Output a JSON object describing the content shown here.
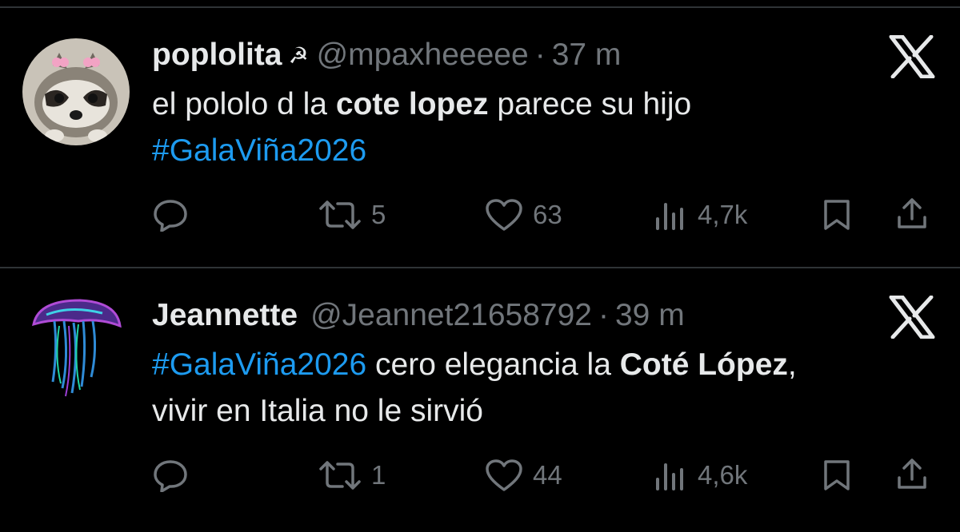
{
  "tweets": [
    {
      "display_name": "poplolita",
      "badge": "☭",
      "handle": "@mpaxheeeee",
      "separator": "·",
      "time": "37 m",
      "text": {
        "part1": "el pololo d la ",
        "bold1": "cote lopez",
        "part2": " parece su hijo",
        "hashtag": "#GalaViña2026"
      },
      "stats": {
        "replies": "",
        "reposts": "5",
        "likes": "63",
        "views": "4,7k"
      }
    },
    {
      "display_name": "Jeannette",
      "handle": "@Jeannet21658792",
      "separator": "·",
      "time": "39 m",
      "text": {
        "hashtag": "#GalaViña2026",
        "part1": " cero elegancia la ",
        "bold1": "Coté López",
        "part2": ",",
        "line2": "vivir en Italia no le sirvió"
      },
      "stats": {
        "replies": "",
        "reposts": "1",
        "likes": "44",
        "views": "4,6k"
      }
    }
  ],
  "icons": [
    "avatar-raccoon",
    "avatar-jellyfish",
    "x-logo-icon",
    "reply-icon",
    "repost-icon",
    "like-icon",
    "views-icon",
    "bookmark-icon",
    "share-icon"
  ],
  "colors": {
    "background": "#000000",
    "text": "#e7e9ea",
    "muted": "#71767b",
    "hashtag": "#1d9bf0",
    "divider": "#2f3336"
  }
}
